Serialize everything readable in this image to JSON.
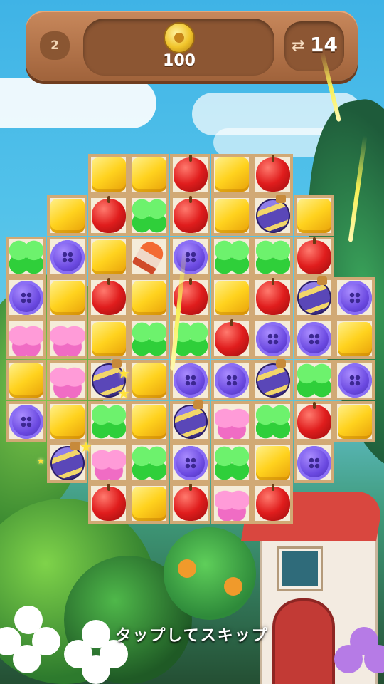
{
  "hud": {
    "level": "2",
    "coins": "100",
    "moves": "14",
    "coin_icon": "gold-coin-icon",
    "moves_icon": "swap-arrows-icon"
  },
  "board": {
    "grid": [
      [
        "",
        "",
        "candy",
        "candy",
        "apple",
        "candy",
        "apple",
        "",
        ""
      ],
      [
        "",
        "candy",
        "apple",
        "clover",
        "apple",
        "candy",
        "bomb",
        "candy",
        ""
      ],
      [
        "clover",
        "button",
        "candy",
        "rocket",
        "button",
        "clover",
        "clover",
        "apple",
        ""
      ],
      [
        "button",
        "candy",
        "apple",
        "candy",
        "apple",
        "candy",
        "apple",
        "bomb",
        "button"
      ],
      [
        "bow",
        "bow",
        "candy",
        "clover",
        "clover",
        "apple",
        "button",
        "button",
        "candy"
      ],
      [
        "candy",
        "bow",
        "bomb",
        "candy",
        "button",
        "button",
        "bomb",
        "clover",
        "button"
      ],
      [
        "button",
        "candy",
        "clover",
        "candy",
        "bomb",
        "bow",
        "clover",
        "apple",
        "candy"
      ],
      [
        "",
        "bomb",
        "bow",
        "clover",
        "button",
        "clover",
        "candy",
        "button",
        ""
      ],
      [
        "",
        "",
        "apple",
        "candy",
        "apple",
        "bow",
        "apple",
        "",
        ""
      ]
    ]
  },
  "overlay": {
    "skip_text": "タップしてスキップ"
  },
  "colors": {
    "wood": "#b0734a",
    "sky": "#4cbde8",
    "tile": "#f5ecd9"
  }
}
